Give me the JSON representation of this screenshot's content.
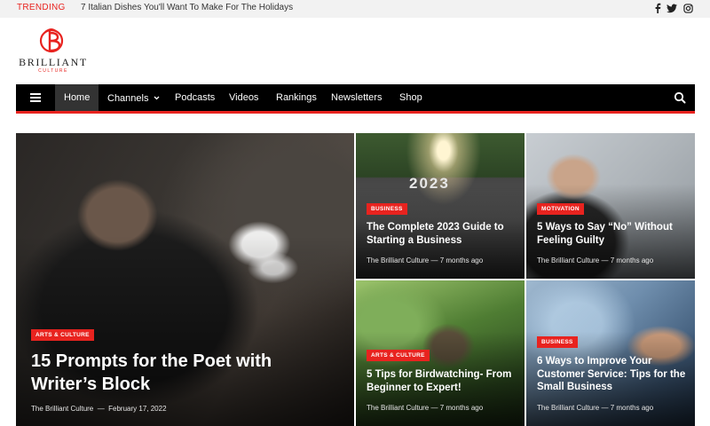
{
  "topbar": {
    "trending_label": "TRENDING",
    "trending_headline": "7 Italian Dishes You'll Want To Make For The Holidays",
    "social": [
      {
        "icon": "facebook-icon",
        "glyph": "f"
      },
      {
        "icon": "twitter-icon",
        "glyph": "t"
      },
      {
        "icon": "instagram-icon",
        "glyph": "ig"
      }
    ]
  },
  "logo": {
    "wordmark": "BRILLIANT",
    "subtitle": "CULTURE",
    "color": "#e8231f"
  },
  "nav": {
    "items": [
      "Home",
      "Channels",
      "Podcasts",
      "Videos",
      "Rankings",
      "Newsletters",
      "Shop"
    ],
    "active": "Home",
    "dropdown_item": "Channels"
  },
  "colors": {
    "accent": "#e8231f",
    "navbar": "#000000"
  },
  "posts": {
    "featured": {
      "category": "ARTS & CULTURE",
      "title": "15 Prompts for the Poet with Writer’s Block",
      "author": "The Brilliant Culture",
      "date": "February 17, 2022"
    },
    "p1": {
      "category": "BUSINESS",
      "title": "The Complete 2023 Guide to Starting a Business",
      "author": "The Brilliant Culture",
      "date": "7 months ago",
      "image_text": "2023"
    },
    "p2": {
      "category": "MOTIVATION",
      "title": "5 Ways to Say “No” Without Feeling Guilty",
      "author": "The Brilliant Culture",
      "date": "7 months ago"
    },
    "p3": {
      "category": "ARTS & CULTURE",
      "title": "5 Tips for Birdwatching- From Beginner to Expert!",
      "author": "The Brilliant Culture",
      "date": "7 months ago"
    },
    "p4": {
      "category": "BUSINESS",
      "title": "6 Ways to Improve Your Customer Service: Tips for the Small Business",
      "author": "The Brilliant Culture",
      "date": "7 months ago"
    }
  }
}
